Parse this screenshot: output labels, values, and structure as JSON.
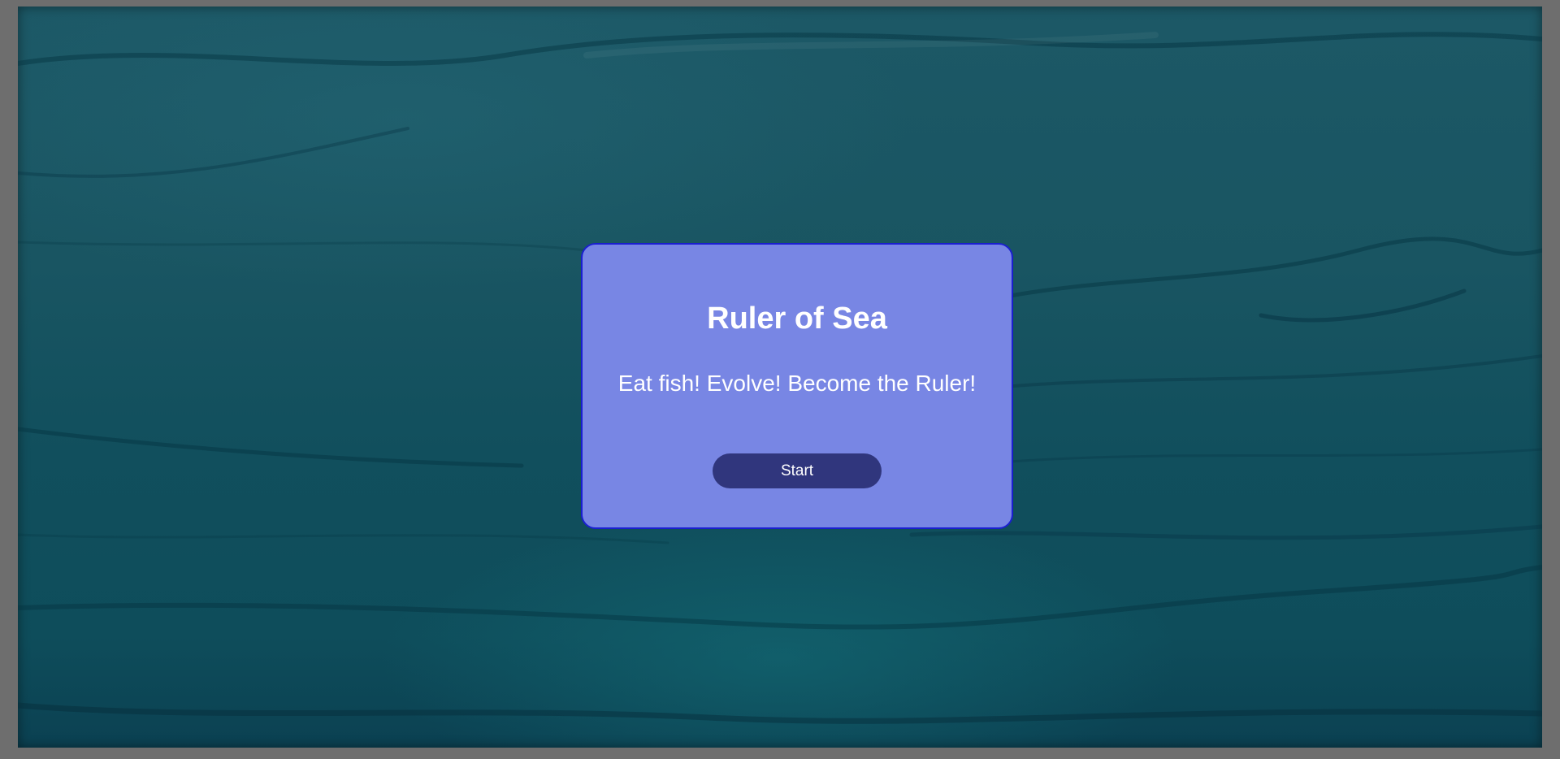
{
  "game": {
    "title": "Ruler of Sea",
    "tagline": "Eat fish! Evolve! Become the Ruler!",
    "start_label": "Start"
  },
  "colors": {
    "page_border": "#6e6e6e",
    "water_dark": "#0b4152",
    "water_light": "#1c5866",
    "modal_background": "#7886e4",
    "modal_border": "#1a1fd0",
    "button_background": "#30367d",
    "text": "#ffffff"
  }
}
